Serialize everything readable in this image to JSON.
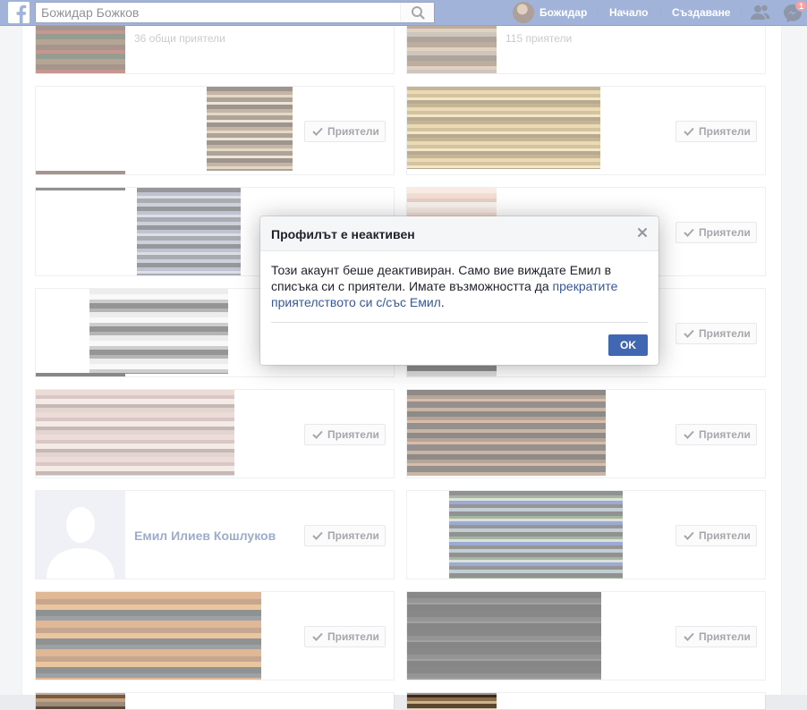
{
  "topbar": {
    "search_value": "Божидар Божков",
    "user_name": "Божидар",
    "nav_home": "Начало",
    "nav_create": "Създаване",
    "messages_badge": "1",
    "brand_color": "#4267b2"
  },
  "cards": {
    "mutual_1": "36 общи приятели",
    "mutual_2": "115 приятели",
    "emil_name": "Емил Илиев Кошлуков",
    "friends_label": "Приятели"
  },
  "dialog": {
    "title": "Профилът е неактивен",
    "body_text": "Този акаунт беше деактивиран. Само вие виждате Емил в списъка си с приятели. Имате възможността да ",
    "link_text": "прекратите приятелството си с/със Емил",
    "body_end": ".",
    "ok_label": "OK"
  },
  "icons": {
    "logo": "facebook-logo-icon",
    "search": "search-icon",
    "friends": "friend-requests-icon",
    "messenger": "messenger-icon",
    "check": "check-icon",
    "close": "close-icon"
  }
}
